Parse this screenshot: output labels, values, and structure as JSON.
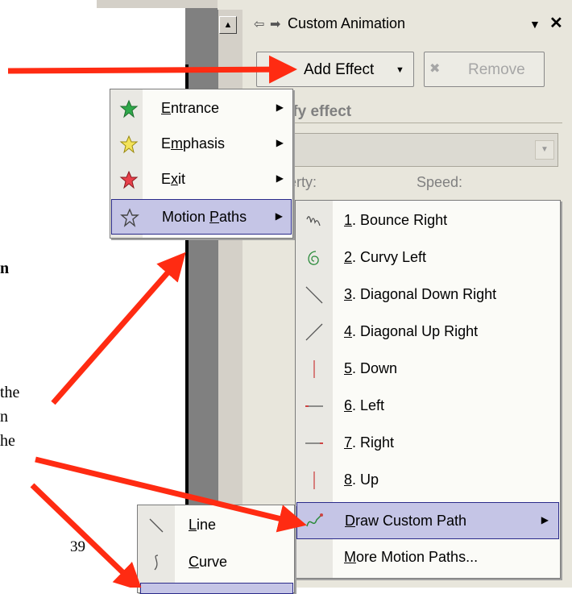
{
  "window": {
    "title": "Custom Animation"
  },
  "toolbar": {
    "add_effect": "Add Effect",
    "remove": "Remove"
  },
  "pane": {
    "section_heading": "ify effect",
    "start_label": ":",
    "property_label": "erty:",
    "speed_label": "Speed:"
  },
  "background_text": {
    "bold_fragment": "n",
    "line_1": "the",
    "line_2": "n",
    "line_3": "he",
    "page_number": "39"
  },
  "add_effect_menu": [
    {
      "pre": "",
      "key": "E",
      "post": "ntrance",
      "icon": "entrance-star-icon"
    },
    {
      "pre": "E",
      "key": "m",
      "post": "phasis",
      "icon": "emphasis-star-icon"
    },
    {
      "pre": "E",
      "key": "x",
      "post": "it",
      "icon": "exit-star-icon"
    },
    {
      "pre": "Motion ",
      "key": "P",
      "post": "aths",
      "icon": "motion-paths-star-icon"
    }
  ],
  "motion_paths_menu": [
    {
      "key": "1",
      "post": ". Bounce Right",
      "icon": "bounce-right-icon"
    },
    {
      "key": "2",
      "post": ". Curvy Left",
      "icon": "curvy-left-icon"
    },
    {
      "key": "3",
      "post": ". Diagonal Down Right",
      "icon": "diagonal-down-right-icon"
    },
    {
      "key": "4",
      "post": ". Diagonal Up Right",
      "icon": "diagonal-up-right-icon"
    },
    {
      "key": "5",
      "post": ". Down",
      "icon": "down-icon"
    },
    {
      "key": "6",
      "post": ". Left",
      "icon": "left-icon"
    },
    {
      "key": "7",
      "post": ". Right",
      "icon": "right-icon"
    },
    {
      "key": "8",
      "post": ". Up",
      "icon": "up-icon"
    },
    {
      "key": "D",
      "post": "raw Custom Path",
      "icon": "draw-custom-path-icon"
    },
    {
      "key": "M",
      "post": "ore Motion Paths...",
      "icon": ""
    }
  ],
  "custom_path_menu": [
    {
      "key": "L",
      "post": "ine",
      "icon": "line-icon"
    },
    {
      "key": "C",
      "post": "urve",
      "icon": "curve-icon"
    }
  ],
  "colors": {
    "highlight": "#c5c5e6",
    "highlight_border": "#2b2b8a",
    "arrow": "#ff2b12"
  }
}
